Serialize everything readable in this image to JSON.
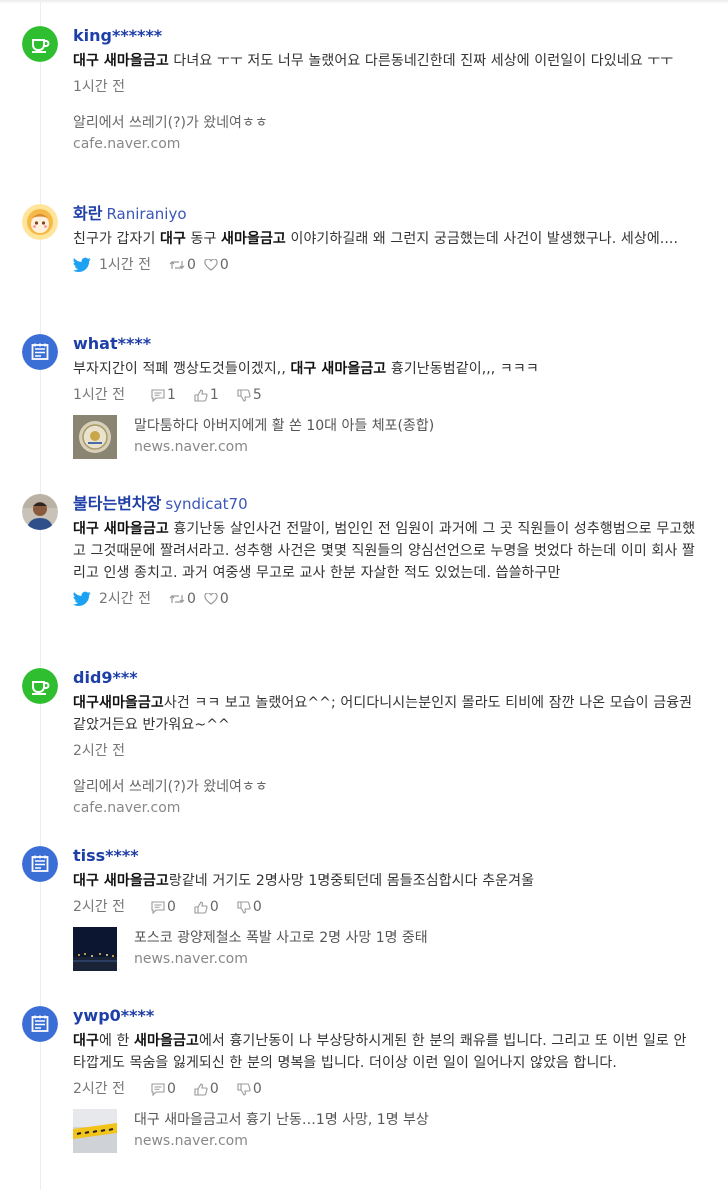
{
  "colors": {
    "author": "#1f3fa8",
    "cafe_green": "#2fbe2f",
    "blog_blue": "#3b6fd6",
    "twitter": "#1da1f2"
  },
  "items": [
    {
      "avatar": "cafe-icon",
      "name": "king******",
      "handle": "",
      "text": [
        {
          "b": true,
          "t": "대구 새마을금고"
        },
        {
          "b": false,
          "t": " 다녀요 ㅜㅜ 저도 너무 놀랬어요 다른동네긴한데 진짜 세상에 이런일이 다있네요 ㅜㅜ"
        }
      ],
      "time": "1시간 전",
      "source_title": "알리에서 쓰레기(?)가 왔네여ㅎㅎ",
      "source_url": "cafe.naver.com"
    },
    {
      "avatar": "cartoon-avatar",
      "name": "화란",
      "handle": "Raniraniyo",
      "text": [
        {
          "b": false,
          "t": "친구가 갑자기 "
        },
        {
          "b": true,
          "t": "대구"
        },
        {
          "b": false,
          "t": " 동구 "
        },
        {
          "b": true,
          "t": "새마을금고"
        },
        {
          "b": false,
          "t": " 이야기하길래 왜 그런지 궁금했는데 사건이 발생했구나. 세상에...."
        }
      ],
      "time": "1시간 전",
      "retweets": "0",
      "likes": "0"
    },
    {
      "avatar": "blog-icon",
      "name": "what****",
      "handle": "",
      "text": [
        {
          "b": false,
          "t": "부자지간이 적폐 깽상도것들이겠지,, "
        },
        {
          "b": true,
          "t": "대구 새마을금고"
        },
        {
          "b": false,
          "t": " 흉기난동범같이,,, ㅋㅋㅋ"
        }
      ],
      "time": "1시간 전",
      "comments": "1",
      "up": "1",
      "down": "5",
      "news_title": "말다툼하다 아버지에게 활 쏜 10대 아들 체포(종합)",
      "news_url": "news.naver.com"
    },
    {
      "avatar": "photo-avatar",
      "name": "불타는변차장",
      "handle": "syndicat70",
      "text": [
        {
          "b": true,
          "t": "대구 새마을금고"
        },
        {
          "b": false,
          "t": " 흉기난동 살인사건 전말이, 범인인 전 임원이 과거에 그 곳 직원들이 성추행범으로 무고했고 그것때문에 짤려서라고. 성추행 사건은 몇몇 직원들의 양심선언으로 누명을 벗었다 하는데 이미 회사 짤리고 인생 종치고. 과거 여중생 무고로 교사 한분 자살한 적도 있었는데. 씁쓸하구만"
        }
      ],
      "time": "2시간 전",
      "retweets": "0",
      "likes": "0"
    },
    {
      "avatar": "cafe-icon",
      "name": "did9***",
      "handle": "",
      "text": [
        {
          "b": true,
          "t": "대구새마을금고"
        },
        {
          "b": false,
          "t": "사건 ㅋㅋ 보고 놀랬어요^^; 어디다니시는분인지 몰라도 티비에 잠깐 나온 모습이 금융권 같았거든요 반가워요~^^"
        }
      ],
      "time": "2시간 전",
      "source_title": "알리에서 쓰레기(?)가 왔네여ㅎㅎ",
      "source_url": "cafe.naver.com"
    },
    {
      "avatar": "blog-icon",
      "name": "tiss****",
      "handle": "",
      "text": [
        {
          "b": true,
          "t": "대구 새마을금고"
        },
        {
          "b": false,
          "t": "랑같네 거기도 2명사망 1명중퇴던데 몸들조심합시다 추운겨울"
        }
      ],
      "time": "2시간 전",
      "comments": "0",
      "up": "0",
      "down": "0",
      "news_title": "포스코 광양제철소 폭발 사고로 2명 사망 1명 중태",
      "news_url": "news.naver.com"
    },
    {
      "avatar": "blog-icon",
      "name": "ywp0****",
      "handle": "",
      "text": [
        {
          "b": true,
          "t": "대구"
        },
        {
          "b": false,
          "t": "에 한 "
        },
        {
          "b": true,
          "t": "새마을금고"
        },
        {
          "b": false,
          "t": "에서 흉기난동이 나 부상당하시게된 한 분의 쾌유를 빕니다. 그리고 또 이번 일로 안타깝게도 목숨을 잃게되신 한 분의 명복을 빕니다. 더이상 이런 일이 일어나지 않았음 합니다."
        }
      ],
      "time": "2시간 전",
      "comments": "0",
      "up": "0",
      "down": "0",
      "news_title": "대구 새마을금고서 흉기 난동…1명 사망, 1명 부상",
      "news_url": "news.naver.com"
    }
  ]
}
